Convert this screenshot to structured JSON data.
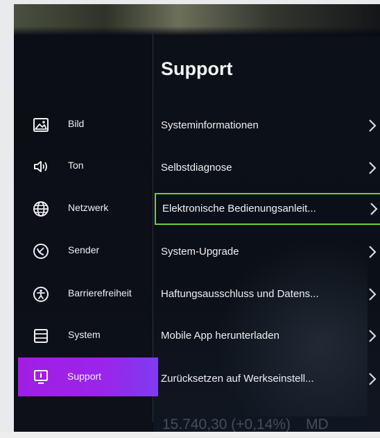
{
  "page": {
    "title": "Support"
  },
  "sidebar": {
    "items": [
      {
        "label": "Bild",
        "icon": "picture-icon"
      },
      {
        "label": "Ton",
        "icon": "speaker-icon"
      },
      {
        "label": "Netzwerk",
        "icon": "globe-icon"
      },
      {
        "label": "Sender",
        "icon": "satellite-dish-icon"
      },
      {
        "label": "Barrierefreiheit",
        "icon": "accessibility-icon"
      },
      {
        "label": "System",
        "icon": "system-list-icon"
      },
      {
        "label": "Support",
        "icon": "support-info-icon",
        "active": true
      }
    ]
  },
  "menu": {
    "items": [
      {
        "label": "Systeminformationen"
      },
      {
        "label": "Selbstdiagnose"
      },
      {
        "label": "Elektronische Bedienungsanleit...",
        "focused": true
      },
      {
        "label": "System-Upgrade"
      },
      {
        "label": "Haftungsausschluss und Datens..."
      },
      {
        "label": "Mobile App herunterladen"
      },
      {
        "label": "Zurücksetzen auf Werkseinstell..."
      }
    ]
  },
  "ticker": {
    "value": "15.740,30 (+0,14%)",
    "code": "MD"
  },
  "colors": {
    "active": "#9b24ea",
    "focus": "#6fcd3a",
    "background": "#070a12"
  }
}
